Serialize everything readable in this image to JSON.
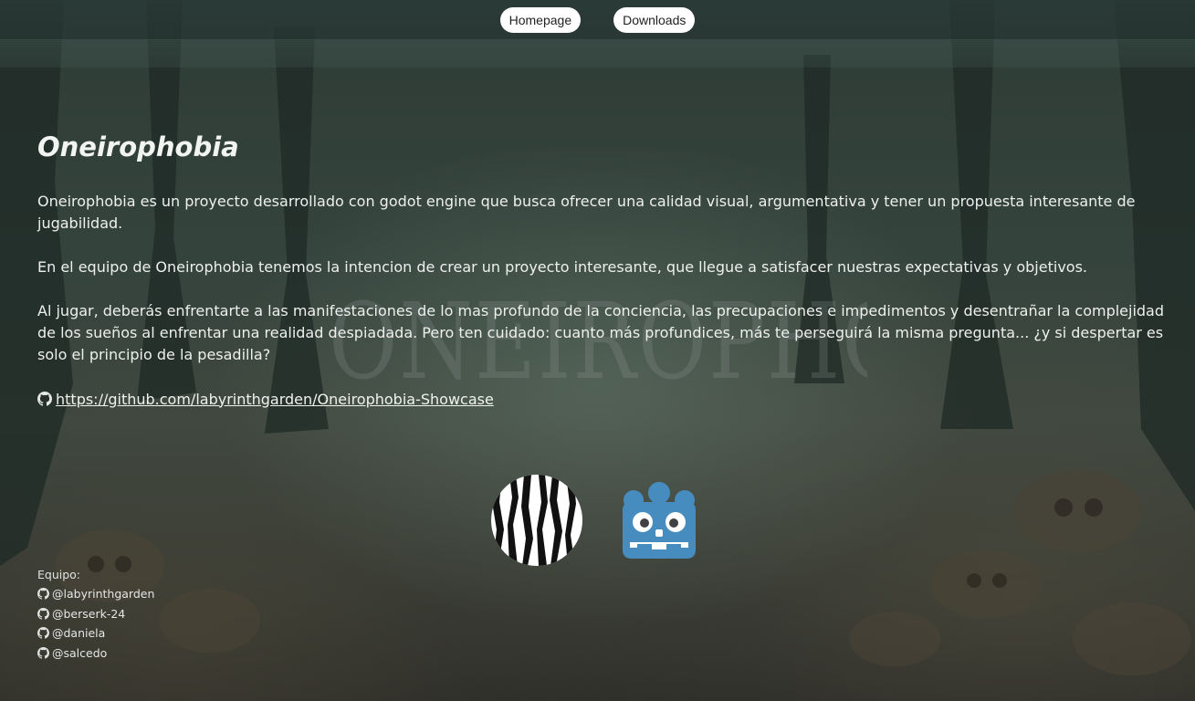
{
  "nav": {
    "items": [
      {
        "label": "Homepage"
      },
      {
        "label": "Downloads"
      }
    ]
  },
  "hero": {
    "watermark": "ONEIROPHOBIA"
  },
  "main": {
    "title": "Oneirophobia",
    "paragraphs": [
      "Oneirophobia es un proyecto desarrollado con godot engine que busca ofrecer una calidad visual, argumentativa y tener un propuesta interesante de jugabilidad.",
      "En el equipo de Oneirophobia tenemos la intencion de crear un proyecto interesante, que llegue a satisfacer nuestras expectativas y objetivos.",
      "Al jugar, deberás enfrentarte a las manifestaciones de lo mas profundo de la conciencia, las precupaciones e impedimentos y desentrañar la complejidad de los sueños al enfrentar una realidad despiadada. Pero ten cuidado: cuanto más profundices, más te perseguirá la misma pregunta... ¿y si despertar es solo el principio de la pesadilla?"
    ],
    "repo_link": "https://github.com/labyrinthgarden/Oneirophobia-Showcase"
  },
  "logos": [
    {
      "icon": "studio-logo-icon"
    },
    {
      "icon": "godot-engine-icon"
    }
  ],
  "team": {
    "label": "Equipo:",
    "members": [
      "@labyrinthgarden",
      "@berserk-24",
      "@daniela",
      "@salcedo"
    ]
  },
  "colors": {
    "background": "#34433c",
    "nav_button": "#ffffff",
    "godot_blue": "#478cbf",
    "text": "#eef0ee"
  }
}
